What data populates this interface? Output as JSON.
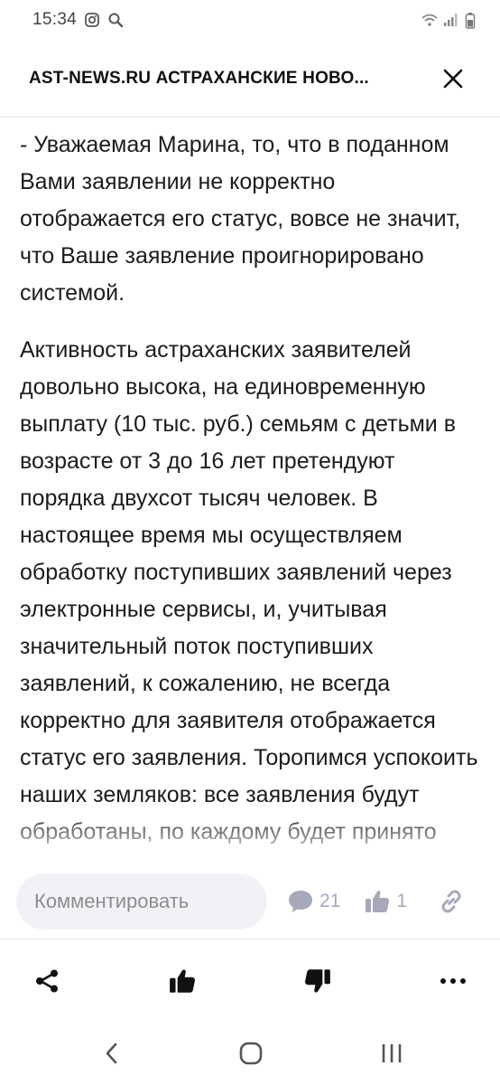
{
  "status_bar": {
    "time": "15:34",
    "left_icons": [
      "instagram-icon",
      "search-icon"
    ],
    "right_icons": [
      "wifi-icon",
      "signal-icon",
      "battery-icon"
    ]
  },
  "header": {
    "title": "AST-NEWS.RU АСТРАХАНСКИЕ НОВО...",
    "close_icon": "close-icon"
  },
  "article": {
    "paragraphs": [
      "- Уважаемая Марина, то, что в поданном Вами заявлении не корректно отображается его статус, вовсе не значит, что Ваше заявление проигнорировано системой.",
      "Активность астраханских заявителей довольно высока, на единовременную выплату (10 тыс. руб.) семьям с детьми в возрасте от 3 до 16 лет претендуют порядка двухсот тысяч человек. В настоящее время мы осуществляем обработку поступивших заявлений через электронные сервисы, и, учитывая значительный поток поступивших заявлений, к сожалению, не всегда корректно для заявителя отображается статус его заявления. Торопимся успокоить наших земляков: все заявления будут обработаны, по каждому будет принято"
    ]
  },
  "comment_bar": {
    "placeholder": "Комментировать",
    "comments_count": "21",
    "likes_count": "1",
    "colors": {
      "icon": "#a6a9ba",
      "input_bg": "#f2f2f6"
    }
  },
  "action_bar": {
    "items": [
      "share-icon",
      "like-icon",
      "dislike-icon",
      "more-icon"
    ]
  },
  "nav_bar": {
    "items": [
      "back-icon",
      "home-icon",
      "recents-icon"
    ]
  }
}
